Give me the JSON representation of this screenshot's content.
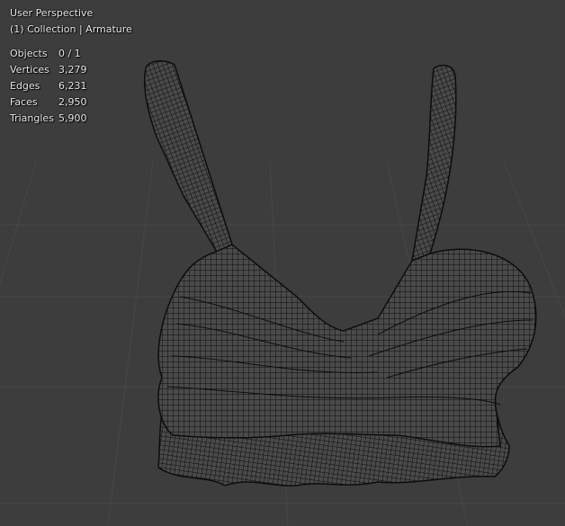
{
  "viewport": {
    "view_name": "User Perspective",
    "collection_line": "(1) Collection | Armature"
  },
  "stats": [
    {
      "label": "Objects",
      "value": "0 / 1"
    },
    {
      "label": "Vertices",
      "value": "3,279"
    },
    {
      "label": "Edges",
      "value": "6,231"
    },
    {
      "label": "Faces",
      "value": "2,950"
    },
    {
      "label": "Triangles",
      "value": "5,900"
    }
  ],
  "colors": {
    "background": "#3d3d3d",
    "grid": "#474747",
    "wire": "#0d0d0d",
    "surface": "#4a4a4a"
  }
}
